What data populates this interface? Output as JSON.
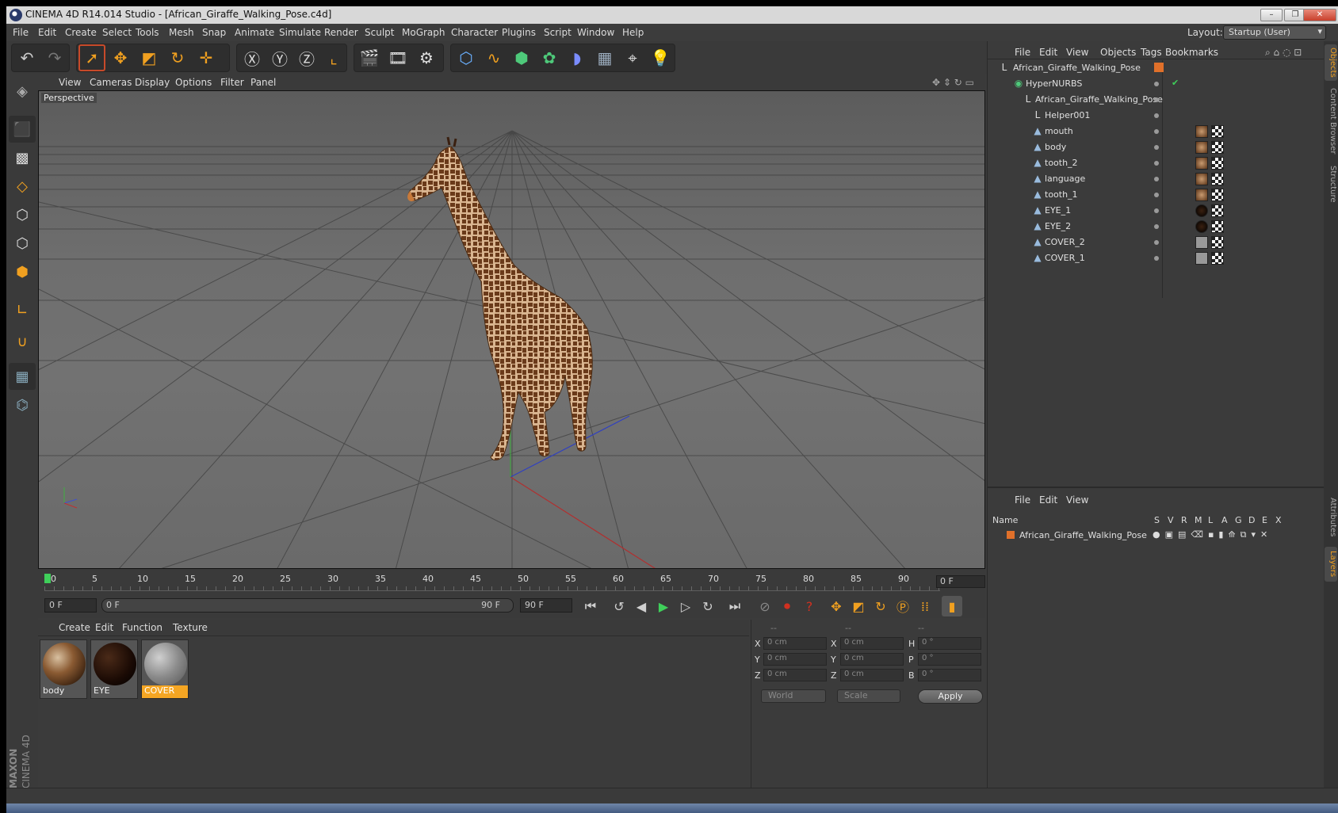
{
  "window": {
    "title": "CINEMA 4D R14.014 Studio - [African_Giraffe_Walking_Pose.c4d]",
    "buttons": [
      "–",
      "❐",
      "✕"
    ]
  },
  "menubar": {
    "items": [
      "File",
      "Edit",
      "Create",
      "Select",
      "Tools",
      "Mesh",
      "Snap",
      "Animate",
      "Simulate",
      "Render",
      "Sculpt",
      "MoGraph",
      "Character",
      "Plugins",
      "Script",
      "Window",
      "Help"
    ],
    "layout_label": "Layout:",
    "layout_value": "Startup (User)"
  },
  "viewport": {
    "menu": [
      "View",
      "Cameras",
      "Display",
      "Options",
      "Filter",
      "Panel"
    ],
    "camera_label": "Perspective"
  },
  "timeline": {
    "ticks": [
      "0",
      "5",
      "10",
      "15",
      "20",
      "25",
      "30",
      "35",
      "40",
      "45",
      "50",
      "55",
      "60",
      "65",
      "70",
      "75",
      "80",
      "85",
      "90"
    ],
    "current_frame": "0 F"
  },
  "transport": {
    "start_field": "0 F",
    "range_start": "0 F",
    "range_end": "90 F",
    "end_field": "90 F"
  },
  "material_manager": {
    "menu": [
      "Create",
      "Edit",
      "Function",
      "Texture"
    ],
    "materials": [
      {
        "name": "body",
        "selected": false
      },
      {
        "name": "EYE",
        "selected": false
      },
      {
        "name": "COVER",
        "selected": true
      }
    ]
  },
  "coordinates": {
    "headers": [
      "--",
      "--",
      "--"
    ],
    "rows": [
      {
        "a": "X",
        "a_val": "0 cm",
        "b": "X",
        "b_val": "0 cm",
        "c": "H",
        "c_val": "0 °"
      },
      {
        "a": "Y",
        "a_val": "0 cm",
        "b": "Y",
        "b_val": "0 cm",
        "c": "P",
        "c_val": "0 °"
      },
      {
        "a": "Z",
        "a_val": "0 cm",
        "b": "Z",
        "b_val": "0 cm",
        "c": "B",
        "c_val": "0 °"
      }
    ],
    "space_dropdown": "World",
    "mode_dropdown": "Scale",
    "apply_label": "Apply"
  },
  "object_manager": {
    "menu": [
      "File",
      "Edit",
      "View",
      "Objects",
      "Tags",
      "Bookmarks"
    ],
    "objects": [
      {
        "name": "African_Giraffe_Walking_Pose",
        "depth": 0,
        "icon": "null-object-icon"
      },
      {
        "name": "HyperNURBS",
        "depth": 1,
        "icon": "hypernurbs-icon"
      },
      {
        "name": "African_Giraffe_Walking_Pose",
        "depth": 2,
        "icon": "null-object-icon"
      },
      {
        "name": "Helper001",
        "depth": 3,
        "icon": "null-object-icon"
      },
      {
        "name": "mouth",
        "depth": 3,
        "icon": "polygon-object-icon"
      },
      {
        "name": "body",
        "depth": 3,
        "icon": "polygon-object-icon"
      },
      {
        "name": "tooth_2",
        "depth": 3,
        "icon": "polygon-object-icon"
      },
      {
        "name": "language",
        "depth": 3,
        "icon": "polygon-object-icon"
      },
      {
        "name": "tooth_1",
        "depth": 3,
        "icon": "polygon-object-icon"
      },
      {
        "name": "EYE_1",
        "depth": 3,
        "icon": "polygon-object-icon"
      },
      {
        "name": "EYE_2",
        "depth": 3,
        "icon": "polygon-object-icon"
      },
      {
        "name": "COVER_2",
        "depth": 3,
        "icon": "polygon-object-icon"
      },
      {
        "name": "COVER_1",
        "depth": 3,
        "icon": "polygon-object-icon"
      }
    ]
  },
  "layer_manager": {
    "menu": [
      "File",
      "Edit",
      "View"
    ],
    "columns": [
      "Name",
      "S",
      "V",
      "R",
      "M",
      "L",
      "A",
      "G",
      "D",
      "E",
      "X"
    ],
    "layers": [
      {
        "name": "African_Giraffe_Walking_Pose",
        "color": "#e0702a"
      }
    ]
  },
  "right_tabs": [
    "Objects",
    "Content Browser",
    "Structure",
    "Attributes",
    "Layers"
  ],
  "logo": {
    "line1": "MAXON",
    "line2": "CINEMA 4D"
  },
  "colors": {
    "accent": "#f0a020",
    "panel": "#3b3b3b",
    "selected_material": "#f5a623"
  }
}
